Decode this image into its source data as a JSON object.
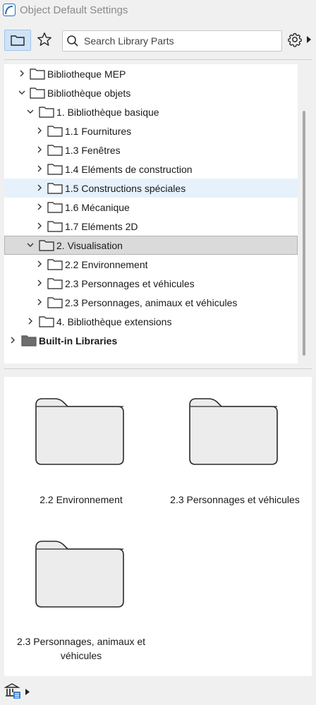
{
  "window": {
    "title": "Object Default Settings"
  },
  "toolbar": {
    "folder_view_icon": "folder-icon",
    "favorites_icon": "star-icon",
    "search": {
      "placeholder": "Search Library Parts",
      "value": ""
    },
    "settings_icon": "gear-icon"
  },
  "tree": {
    "items": [
      {
        "label": "Bibliotheque MEP",
        "expanded": false,
        "level": 1
      },
      {
        "label": "Bibliothèque objets",
        "expanded": true,
        "level": 1
      },
      {
        "label": "1. Bibliothèque basique",
        "expanded": true,
        "level": 2
      },
      {
        "label": "1.1 Fournitures",
        "expanded": false,
        "level": 3
      },
      {
        "label": "1.3 Fenêtres",
        "expanded": false,
        "level": 3
      },
      {
        "label": "1.4 Eléments de construction",
        "expanded": false,
        "level": 3
      },
      {
        "label": "1.5 Constructions spéciales",
        "expanded": false,
        "level": 3,
        "hovered": true
      },
      {
        "label": "1.6 Mécanique",
        "expanded": false,
        "level": 3
      },
      {
        "label": "1.7 Eléments 2D",
        "expanded": false,
        "level": 3
      },
      {
        "label": "2. Visualisation",
        "expanded": true,
        "level": 2,
        "selected": true
      },
      {
        "label": "2.2 Environnement",
        "expanded": false,
        "level": 3
      },
      {
        "label": "2.3 Personnages et véhicules",
        "expanded": false,
        "level": 3
      },
      {
        "label": "2.3 Personnages, animaux et véhicules",
        "expanded": false,
        "level": 3
      },
      {
        "label": "4. Bibliothèque extensions",
        "expanded": false,
        "level": 2
      },
      {
        "label": "Built-in Libraries",
        "expanded": false,
        "level": 0,
        "bold": true
      }
    ]
  },
  "grid": {
    "tiles": [
      {
        "label": "2.2 Environnement"
      },
      {
        "label": "2.3 Personnages et véhicules"
      },
      {
        "label": "2.3 Personnages, animaux et véhicules"
      }
    ]
  },
  "bottom_bar": {
    "library_manager_icon": "library-icon"
  },
  "colors": {
    "hover": "#e6f1fb",
    "selected": "#dadada",
    "folder_fill": "#ececec",
    "accent": "#cfe3f7"
  }
}
